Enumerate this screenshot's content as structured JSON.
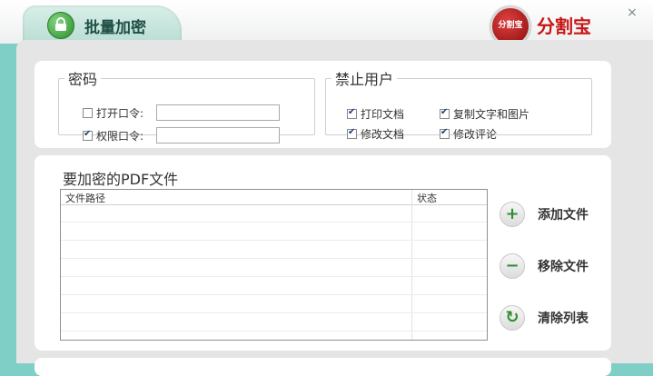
{
  "header": {
    "tab_title": "批量加密",
    "logo_badge_text": "分割宝",
    "logo_text": "分割宝",
    "close_symbol": "×"
  },
  "password_group": {
    "legend": "密码",
    "open_password": {
      "label": "打开口令:",
      "checked": false,
      "value": ""
    },
    "permission_password": {
      "label": "权限口令:",
      "checked": true,
      "value": ""
    }
  },
  "forbid_group": {
    "legend": "禁止用户",
    "options": [
      {
        "label": "打印文档",
        "checked": true
      },
      {
        "label": "复制文字和图片",
        "checked": true
      },
      {
        "label": "修改文档",
        "checked": true
      },
      {
        "label": "修改评论",
        "checked": true
      }
    ]
  },
  "files": {
    "title": "要加密的PDF文件",
    "columns": [
      "文件路径",
      "状态"
    ],
    "rows": []
  },
  "actions": {
    "add": {
      "label": "添加文件",
      "icon": "plus-icon",
      "symbol": "+"
    },
    "remove": {
      "label": "移除文件",
      "icon": "minus-icon",
      "symbol": "−"
    },
    "clear": {
      "label": "清除列表",
      "icon": "refresh-icon",
      "symbol": "↻"
    }
  },
  "colors": {
    "accent_green": "#2e8b2e",
    "brand_red": "#c81414",
    "background": "#7fcfc6"
  }
}
